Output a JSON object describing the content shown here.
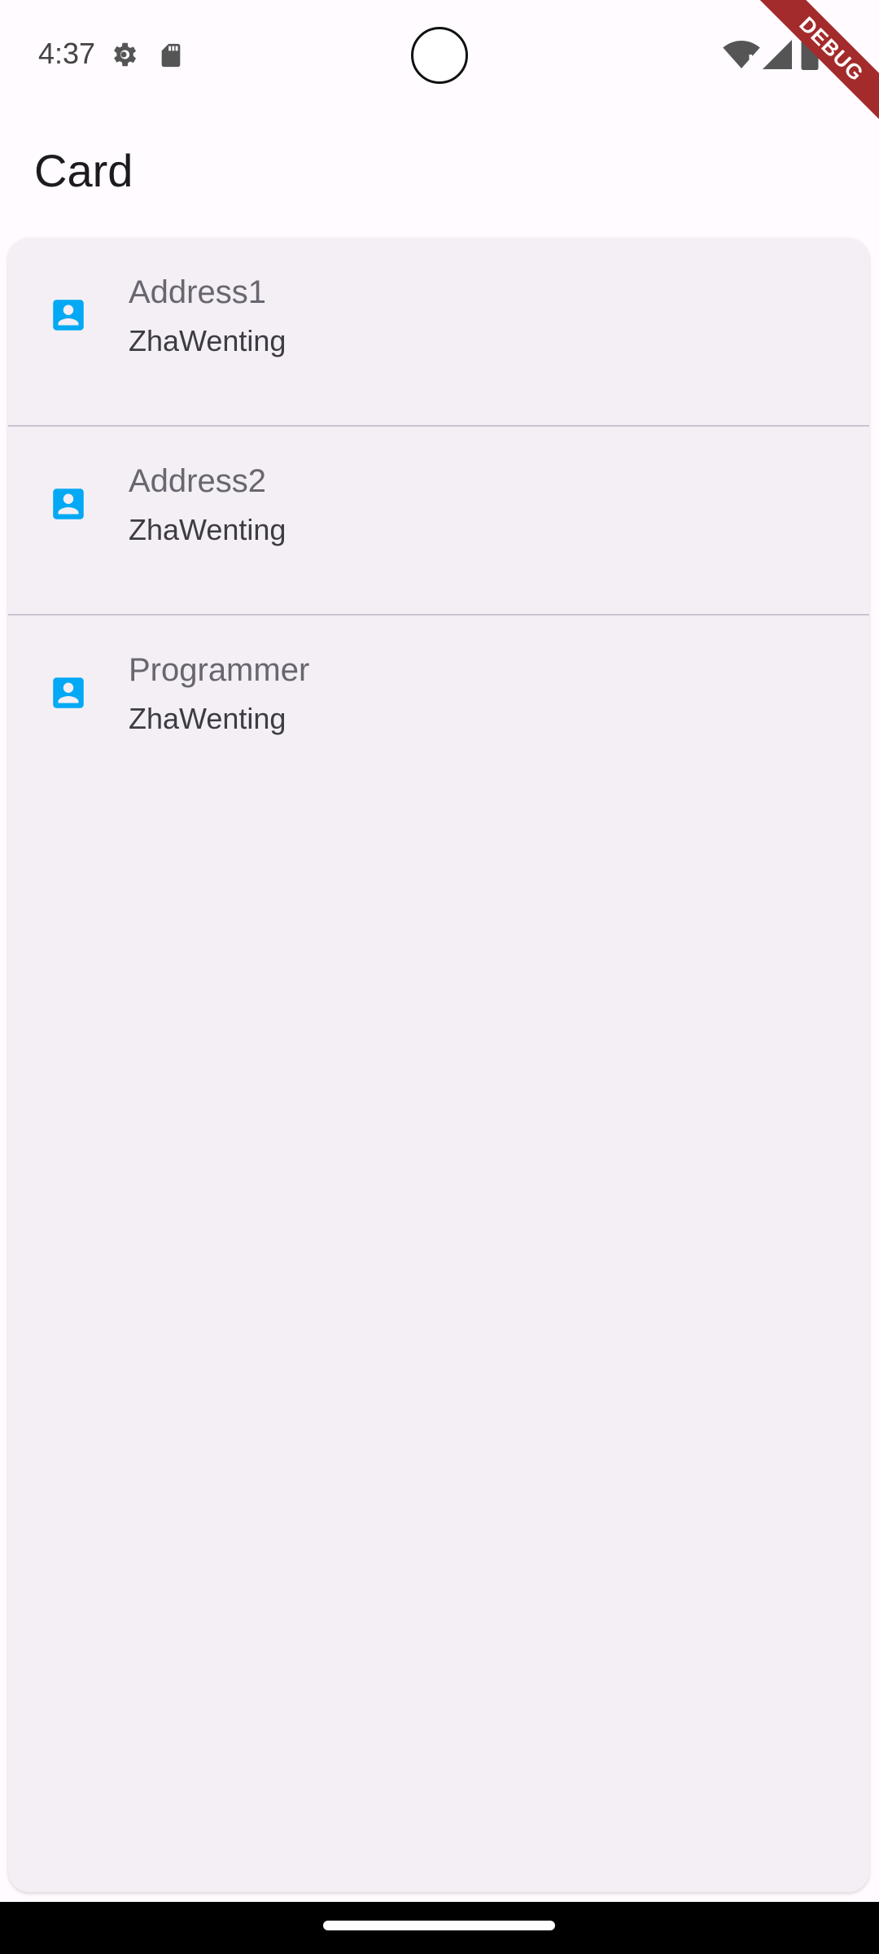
{
  "status_bar": {
    "time": "4:37",
    "icons": [
      "gear-icon",
      "sd-card-icon",
      "wifi-icon",
      "signal-icon",
      "battery-icon"
    ]
  },
  "debug_ribbon": "DEBUG",
  "app_bar": {
    "title": "Card"
  },
  "list": {
    "items": [
      {
        "title": "Address1",
        "subtitle": "ZhaWenting",
        "icon": "account-box-icon"
      },
      {
        "title": "Address2",
        "subtitle": "ZhaWenting",
        "icon": "account-box-icon"
      },
      {
        "title": "Programmer",
        "subtitle": "ZhaWenting",
        "icon": "account-box-icon"
      }
    ]
  },
  "colors": {
    "icon_accent": "#03A9F4",
    "card_background": "#F3EFF5",
    "page_background": "#FFFBFE",
    "debug_ribbon": "#A32B2B"
  }
}
